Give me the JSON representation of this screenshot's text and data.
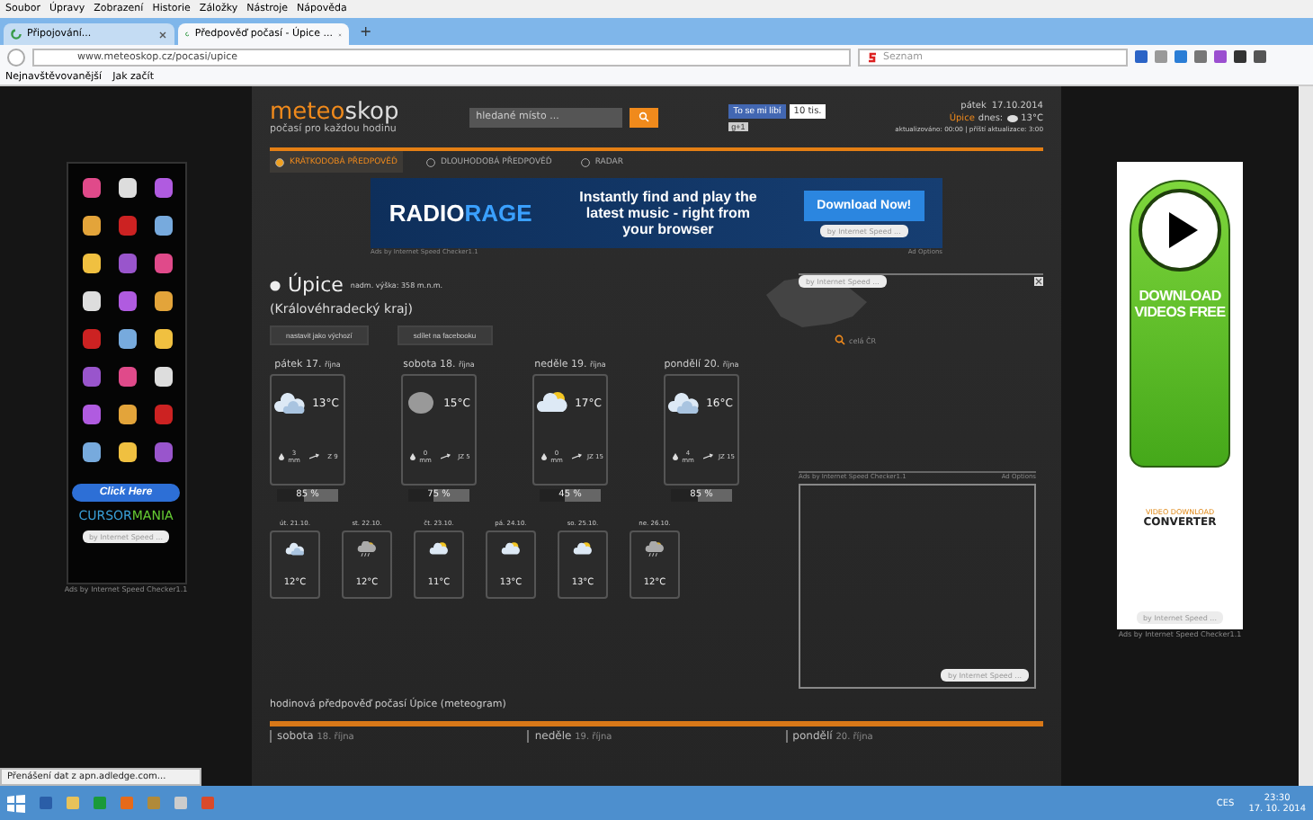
{
  "browser": {
    "menu": [
      "Soubor",
      "Úpravy",
      "Zobrazení",
      "Historie",
      "Záložky",
      "Nástroje",
      "Nápověda"
    ],
    "tabs": [
      {
        "label": "Připojování...",
        "selected": false
      },
      {
        "label": "Předpověď počasí - Úpice ...",
        "selected": true
      }
    ],
    "new_tab": "+",
    "address": "www.meteoskop.cz/pocasi/upice",
    "search": {
      "placeholder": "Seznam"
    },
    "bookmarks": [
      "Nejnavštěvovanější",
      "Jak začít"
    ]
  },
  "site": {
    "logo": {
      "part_1": "meteo",
      "part_2": "skop"
    },
    "tagline": "počasí pro každou hodinu",
    "search": {
      "placeholder": "hledané místo ..."
    },
    "like": {
      "label": "To se mi líbí",
      "count": "10 tis."
    },
    "plus": "g+1",
    "day": "pátek",
    "date": "17.10.2014",
    "today_place": "Úpice",
    "today_label": "dnes:",
    "today_temp": "13°C",
    "updated": "aktualizováno: 00:00 | příští aktualizace: 3:00",
    "nav": [
      {
        "label": "KRÁTKODOBÁ PŘEDPOVĚĎ",
        "selected": true
      },
      {
        "label": "DLOUHODOBÁ PŘEDPOVĚĎ",
        "selected": false
      },
      {
        "label": "RADAR",
        "selected": false
      }
    ]
  },
  "banner": {
    "brand_1": "RADIO",
    "brand_2": "RAGE",
    "text": "Instantly find and play the latest music - right from your browser",
    "button": "Download Now!",
    "by": "by Internet Speed ...",
    "caption": "Ads by Internet Speed Checker1.1",
    "options": "Ad Options"
  },
  "city": {
    "name": "Úpice",
    "altitude": "nadm. výška: 358 m.n.m.",
    "region": "(Královéhradecký kraj)",
    "buttons": [
      "nastavit jako výchozí",
      "sdílet na facebooku"
    ],
    "map_link": "celá ČR",
    "map_by": "by Internet Speed ..."
  },
  "days": [
    {
      "day": "pátek 17.",
      "month": "října",
      "kind": "cloudy",
      "temp": "13°C",
      "rain": "3 mm",
      "wind": "Z 9",
      "prob": "85 %",
      "level": 0.45
    },
    {
      "day": "sobota 18.",
      "month": "října",
      "kind": "overcast",
      "temp": "15°C",
      "rain": "0 mm",
      "wind": "JZ 5",
      "prob": "75 %",
      "level": 0.4
    },
    {
      "day": "neděle 19.",
      "month": "října",
      "kind": "sunny",
      "temp": "17°C",
      "rain": "0 mm",
      "wind": "JZ 15",
      "prob": "45 %",
      "level": 0.4
    },
    {
      "day": "pondělí 20.",
      "month": "října",
      "kind": "cloudy",
      "temp": "16°C",
      "rain": "4 mm",
      "wind": "JZ 15",
      "prob": "85 %",
      "level": 0.45
    }
  ],
  "later_days": [
    {
      "day": "út. 21.10.",
      "kind": "cloudy",
      "temp": "12°C"
    },
    {
      "day": "st. 22.10.",
      "kind": "rain",
      "temp": "12°C"
    },
    {
      "day": "čt. 23.10.",
      "kind": "sunny",
      "temp": "11°C"
    },
    {
      "day": "pá. 24.10.",
      "kind": "sunny",
      "temp": "13°C"
    },
    {
      "day": "so. 25.10.",
      "kind": "sunny",
      "temp": "13°C"
    },
    {
      "day": "ne. 26.10.",
      "kind": "rain",
      "temp": "12°C"
    }
  ],
  "side_ad": {
    "caption": "Ads by Internet Speed Checker1.1",
    "options": "Ad Options",
    "by": "by Internet Speed ..."
  },
  "meteogram": {
    "title": "hodinová předpověď počasí Úpice (meteogram)",
    "days": [
      {
        "day": "sobota",
        "date": "18. října"
      },
      {
        "day": "neděle",
        "date": "19. října"
      },
      {
        "day": "pondělí",
        "date": "20. října"
      }
    ]
  },
  "left_ad": {
    "button": "Click Here",
    "brand_1": "CURSOR",
    "brand_2": "MANIA",
    "by": "by Internet Speed ...",
    "caption": "Ads by Internet Speed Checker1.1"
  },
  "right_ad": {
    "text": "DOWNLOAD VIDEOS FREE",
    "brand_1": "VIDEO",
    "brand_2": "DOWNLOAD",
    "brand_3": "CONVERTER",
    "by": "by Internet Speed ...",
    "caption": "Ads by Internet Speed Checker1.1"
  },
  "status": "Přenášení dat z apn.adledge.com...",
  "taskbar": {
    "language": "CES",
    "time": "23:30",
    "date": "17. 10. 2014"
  }
}
